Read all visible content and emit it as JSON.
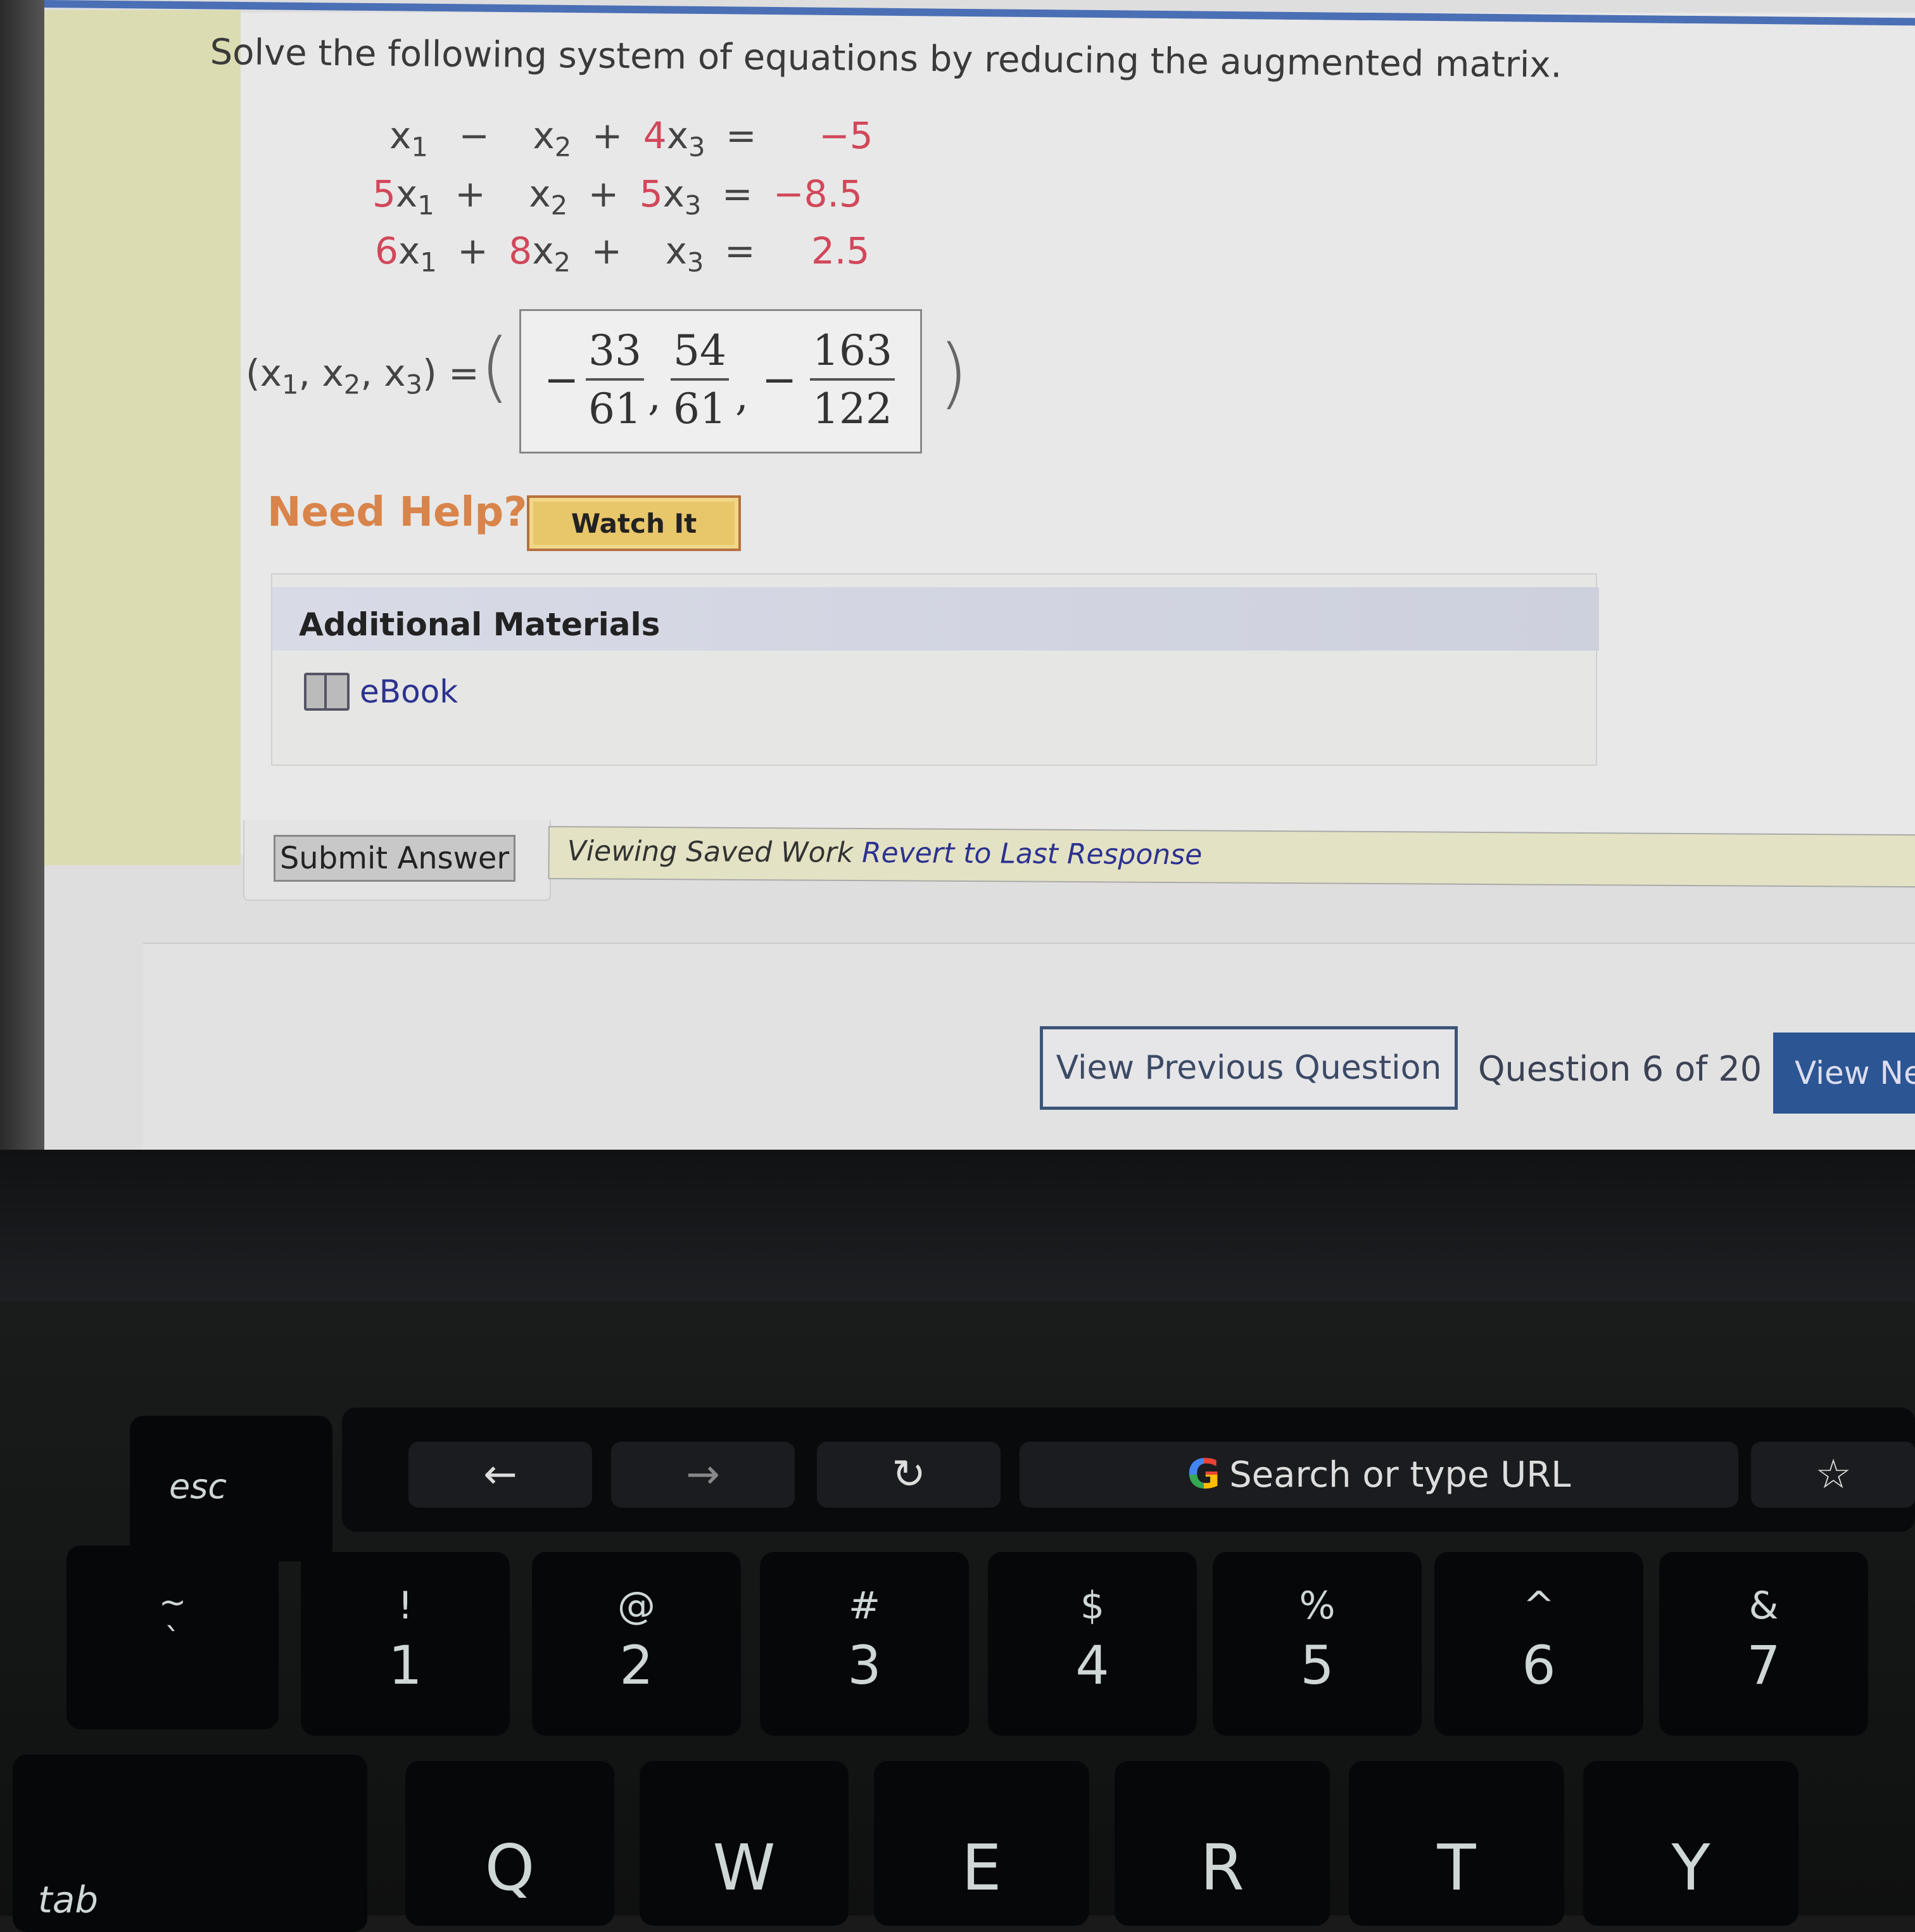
{
  "question": {
    "prompt": "Solve the following system of equations by reducing the augmented matrix.",
    "equations": [
      {
        "c1": "",
        "v1": "x",
        "s1": "1",
        "op1": "−",
        "c2": "",
        "v2": "x",
        "s2": "2",
        "op2": "+",
        "c3": "4",
        "v3": "x",
        "s3": "3",
        "eq": "=",
        "rhs": "−5"
      },
      {
        "c1": "5",
        "v1": "x",
        "s1": "1",
        "op1": "+",
        "c2": "",
        "v2": "x",
        "s2": "2",
        "op2": "+",
        "c3": "5",
        "v3": "x",
        "s3": "3",
        "eq": "=",
        "rhs": "−8.5"
      },
      {
        "c1": "6",
        "v1": "x",
        "s1": "1",
        "op1": "+",
        "c2": "8",
        "v2": "x",
        "s2": "2",
        "op2": "+",
        "c3": "",
        "v3": "x",
        "s3": "3",
        "eq": "=",
        "rhs": "2.5"
      }
    ],
    "tuple_label": {
      "open": "(",
      "x": "x",
      "s1": "1",
      "s2": "2",
      "s3": "3",
      "sep": ", ",
      "close": ")",
      "eq": " ="
    },
    "paren_open": "(",
    "paren_close": ")",
    "answer": {
      "x1": {
        "sign": "−",
        "num": "33",
        "den": "61"
      },
      "x2": {
        "sign": "",
        "num": "54",
        "den": "61"
      },
      "x3": {
        "sign": "−",
        "num": "163",
        "den": "122"
      },
      "comma": ","
    }
  },
  "help": {
    "need_help_label": "Need Help?",
    "watch_it_label": "Watch It"
  },
  "additional_materials": {
    "title": "Additional Materials",
    "items": [
      {
        "icon": "book-icon",
        "label": "eBook"
      }
    ]
  },
  "actions": {
    "submit_label": "Submit Answer",
    "viewing_text": "Viewing Saved Work",
    "revert_link": "Revert to Last Response"
  },
  "navigation": {
    "prev_label": "View Previous Question",
    "counter": "Question 6 of 20",
    "next_label": "View Ne"
  },
  "colors": {
    "accent_blue": "#2b5593",
    "coefficient_red": "#d2475a",
    "help_orange": "#d9844a",
    "watch_button": "#e8c66a",
    "link_blue": "#2c3290"
  },
  "touchbar": {
    "esc": "esc",
    "back": "←",
    "forward": "→",
    "reload": "↻",
    "google": "G",
    "search_placeholder": "Search or type URL",
    "bookmark": "☆"
  },
  "keyboard": {
    "number_row": [
      {
        "top": "~",
        "bottom": "`"
      },
      {
        "top": "!",
        "bottom": "1"
      },
      {
        "top": "@",
        "bottom": "2"
      },
      {
        "top": "#",
        "bottom": "3"
      },
      {
        "top": "$",
        "bottom": "4"
      },
      {
        "top": "%",
        "bottom": "5"
      },
      {
        "top": "^",
        "bottom": "6"
      },
      {
        "top": "&",
        "bottom": "7"
      }
    ],
    "letter_row": [
      "Q",
      "W",
      "E",
      "R",
      "T",
      "Y"
    ],
    "tab": "tab"
  }
}
